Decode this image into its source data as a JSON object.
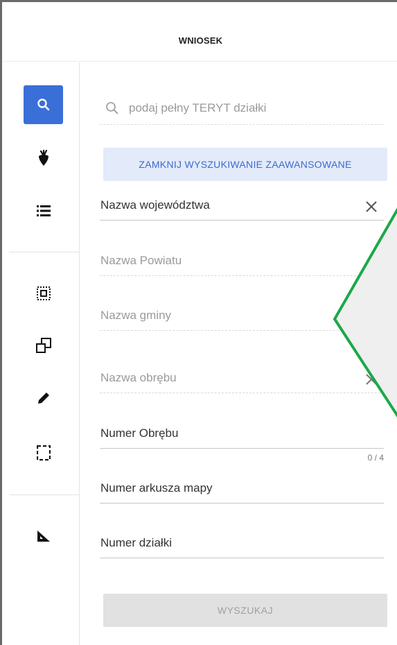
{
  "header": {
    "title": "WNIOSEK"
  },
  "sidebar": {
    "items": [
      {
        "icon": "search-icon",
        "active": true
      },
      {
        "icon": "beet-icon",
        "active": false
      },
      {
        "icon": "list-icon",
        "active": false
      },
      {
        "icon": "select-area-icon",
        "active": false
      },
      {
        "icon": "copy-shapes-icon",
        "active": false
      },
      {
        "icon": "pencil-icon",
        "active": false
      },
      {
        "icon": "dashed-rectangle-icon",
        "active": false
      },
      {
        "icon": "ruler-triangle-icon",
        "active": false
      }
    ],
    "accent_color": "#3a6fd8"
  },
  "search": {
    "placeholder": "podaj pełny TERYT działki"
  },
  "advanced_toggle": {
    "label": "ZAMKNIJ WYSZUKIWANIE ZAAWANSOWANE"
  },
  "fields": {
    "wojewodztwo": {
      "label": "Nazwa województwa"
    },
    "powiat": {
      "label": "Nazwa Powiatu"
    },
    "gmina": {
      "label": "Nazwa gminy"
    },
    "obreb": {
      "label": "Nazwa obrębu"
    },
    "numer_obrebu": {
      "label": "Numer Obrębu",
      "counter": "0 / 4"
    },
    "arkusz": {
      "label": "Numer arkusza mapy"
    },
    "dzialka": {
      "label": "Numer działki"
    }
  },
  "submit": {
    "label": "WYSZUKAJ"
  },
  "callout": {
    "border_color": "#1ba84a",
    "fill_color": "#efefef"
  }
}
